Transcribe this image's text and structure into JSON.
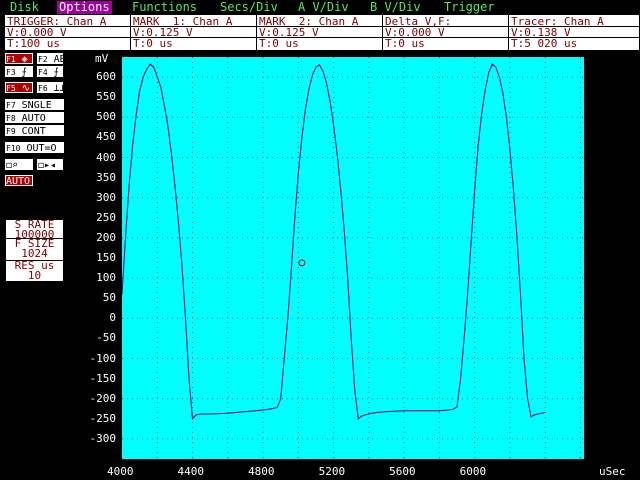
{
  "menu": [
    "Disk",
    "Options",
    "Functions",
    "Secs/Div",
    "A V/Div",
    "B V/Div",
    "Trigger"
  ],
  "menu_active": "Options",
  "info_panels": [
    {
      "title": "TRIGGER: Chan A",
      "v": "V:0.000 V",
      "t": "T:100 us"
    },
    {
      "title": "MARK  1: Chan A",
      "v": "V:0.125 V",
      "t": "T:0 us"
    },
    {
      "title": "MARK  2: Chan A",
      "v": "V:0.125 V",
      "t": "T:0 us"
    },
    {
      "title": "Delta V,F:",
      "v": "V:0.000 V",
      "t": "T:0 us"
    },
    {
      "title": "Tracer: Chan A",
      "v": "V:0.138 V",
      "t": "T:5 020 us"
    }
  ],
  "fkeys": [
    {
      "num": "F1",
      "label": "◈",
      "highlight": true
    },
    {
      "num": "F2",
      "label": "AB",
      "highlight": false
    },
    {
      "num": "F3",
      "label": "⨍",
      "highlight": false
    },
    {
      "num": "F4",
      "label": "⨍",
      "highlight": false
    },
    {
      "num": "F5",
      "label": "∿",
      "highlight": true
    },
    {
      "num": "F6",
      "label": "⊥⊥",
      "highlight": false
    },
    {
      "num": "F7",
      "label": "SNGLE",
      "highlight": false
    },
    {
      "num": "F8",
      "label": "AUTO",
      "highlight": false
    },
    {
      "num": "F9",
      "label": "CONT",
      "highlight": false
    },
    {
      "num": "F10",
      "label": "OUT=O",
      "highlight": false
    },
    {
      "num": "",
      "label": "◻⌕",
      "highlight": false
    },
    {
      "num": "",
      "label": "◻▸◂",
      "highlight": false
    },
    {
      "num": "",
      "label": "AUTO",
      "highlight": true
    }
  ],
  "status": {
    "srate_label": "S RATE",
    "srate_value": "100000",
    "fsize_label": "F SIZE",
    "fsize_value": "1024",
    "res_label": "RES us",
    "res_value": "10"
  },
  "chart_data": {
    "type": "line",
    "ylabel": "mV",
    "xlabel": "uSec",
    "xlim": [
      4000,
      6620
    ],
    "ylim": [
      -350,
      650
    ],
    "yticks": [
      600,
      550,
      500,
      450,
      400,
      350,
      300,
      250,
      200,
      150,
      100,
      50,
      0,
      -50,
      -100,
      -150,
      -200,
      -250,
      -300
    ],
    "xticks": [
      4000,
      4400,
      4800,
      5200,
      5600,
      6000
    ],
    "x": [
      4000,
      4020,
      4040,
      4060,
      4080,
      4100,
      4120,
      4140,
      4160,
      4180,
      4200,
      4220,
      4240,
      4260,
      4280,
      4300,
      4320,
      4340,
      4360,
      4380,
      4400,
      4420,
      4450,
      4500,
      4600,
      4700,
      4800,
      4850,
      4880,
      4900,
      4920,
      4940,
      4960,
      4980,
      5000,
      5020,
      5040,
      5060,
      5080,
      5100,
      5120,
      5140,
      5160,
      5180,
      5200,
      5220,
      5240,
      5260,
      5280,
      5300,
      5320,
      5340,
      5360,
      5380,
      5400,
      5420,
      5450,
      5500,
      5600,
      5700,
      5800,
      5850,
      5880,
      5900,
      5920,
      5940,
      5960,
      5980,
      6000,
      6020,
      6040,
      6060,
      6080,
      6100,
      6120,
      6140,
      6160,
      6180,
      6200,
      6220,
      6240,
      6260,
      6280,
      6300,
      6320,
      6340,
      6360,
      6380,
      6400
    ],
    "y": [
      60,
      200,
      330,
      430,
      505,
      565,
      600,
      620,
      632,
      625,
      600,
      575,
      530,
      480,
      410,
      330,
      240,
      130,
      0,
      -150,
      -250,
      -240,
      -238,
      -238,
      -236,
      -232,
      -228,
      -225,
      -222,
      -200,
      -100,
      0,
      120,
      250,
      360,
      450,
      520,
      570,
      605,
      625,
      630,
      615,
      585,
      540,
      480,
      410,
      320,
      220,
      100,
      -50,
      -180,
      -250,
      -243,
      -240,
      -238,
      -236,
      -234,
      -232,
      -230,
      -230,
      -230,
      -228,
      -226,
      -220,
      -150,
      -50,
      60,
      190,
      320,
      430,
      510,
      570,
      612,
      632,
      625,
      600,
      560,
      500,
      420,
      320,
      200,
      60,
      -100,
      -200,
      -245,
      -240,
      -238,
      -236,
      -234
    ],
    "series": [
      {
        "color": "#000080"
      }
    ],
    "grid": true,
    "tracer": {
      "x": 5020,
      "y": 138
    }
  }
}
